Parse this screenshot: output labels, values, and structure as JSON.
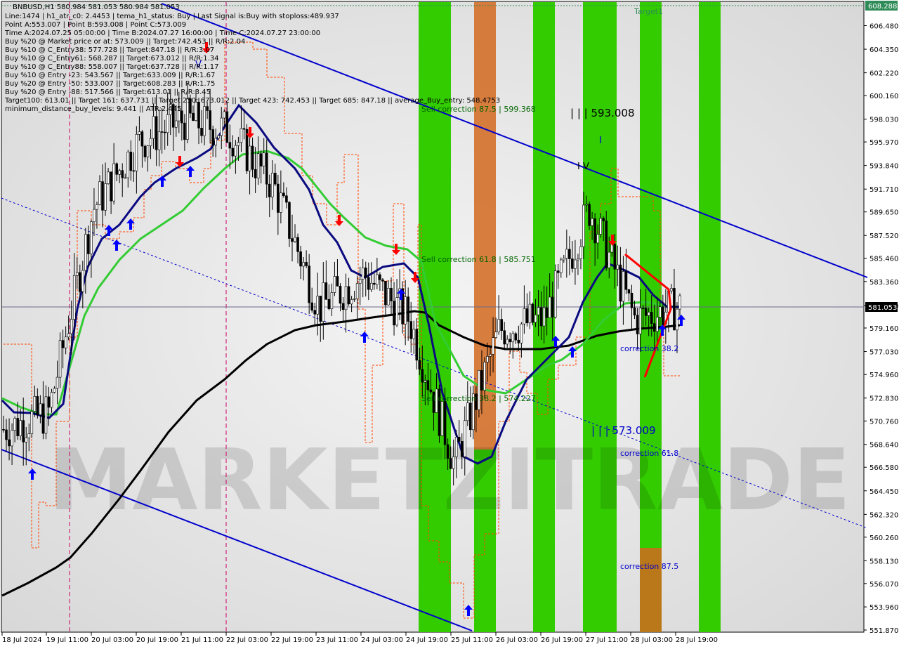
{
  "header": {
    "symbol": "BNBUSD,H1  580.984 581.053 580.984 581.053",
    "lines": [
      "Line:1474  |  h1_atr_c0: 2.4453  |  tema_h1_status: Buy  |  Last Signal is:Buy with stoploss:489.937",
      "Point A:553.007  |  Point B:593.008  |  Point C:573.009",
      "Time A:2024.07.25 05:00:00  |  Time B:2024.07.27 16:00:00  |  Time C:2024.07.27 23:00:00",
      "Buy %20 @ Market price or at: 573.009  ||  Target:742.453  ||  R/R:2.04",
      "Buy %10 @ C_Entry38: 577.728  ||  Target:847.18  ||  R/R:3.07",
      "Buy %10 @ C_Entry61: 568.287  ||  Target:673.012  ||  R/R:1.34",
      "Buy %10 @ C_Entry88: 558.007  ||  Target:637.728  ||  R/R:1.17",
      "Buy %10 @ Entry -23: 543.567  ||  Target:633.009  ||  R/R:1.67",
      "Buy %20 @ Entry -50: 533.007  ||  Target:608.283  ||  R/R:1.75",
      "Buy %20 @ Entry -88: 517.566  ||  Target:613.01  ||  R/R:3.45",
      "Target100: 613.01  ||  Target 161: 637.731  ||  Target 250: 673.012  ||  Target 423: 742.453  ||  Target 685: 847.18  ||  average_Buy_entry: 548.4753",
      "minimum_distance_buy_levels: 9.441  ||  ATR:2.445"
    ]
  },
  "watermark": "MARKETZITRADE",
  "annotations": {
    "sell_correction_875": "Sell correction 87.5 | 599.368",
    "sell_correction_618": "Sell correction 61.8 | 585.751",
    "sell_correction_382": "Sell correction 38.2 | 574.227",
    "point_b": "| | | 593.008",
    "point_c": "| | | 573.009",
    "wave_iv": "I V",
    "wave_v": "V",
    "wave_i": "I",
    "target1": "Target1",
    "correction_382": "correction 38.2",
    "correction_618": "correction 61.8",
    "correction_875": "correction 87.5"
  },
  "price_axis": {
    "ticks": [
      "606.480",
      "604.350",
      "602.220",
      "600.160",
      "598.030",
      "595.970",
      "593.840",
      "591.710",
      "589.650",
      "587.520",
      "585.460",
      "583.360",
      "581.200",
      "579.160",
      "577.030",
      "574.960",
      "572.830",
      "570.760",
      "568.640",
      "566.580",
      "564.450",
      "562.320",
      "560.260",
      "558.130",
      "556.070",
      "553.960",
      "551.870"
    ],
    "current_price": "581.053",
    "top_label": "608.288",
    "current_color": "#000000",
    "top_color": "#2e8b57"
  },
  "time_axis": {
    "ticks": [
      "18 Jul 2024",
      "19 Jul 11:00",
      "20 Jul 03:00",
      "20 Jul 19:00",
      "21 Jul 11:00",
      "22 Jul 03:00",
      "22 Jul 19:00",
      "23 Jul 11:00",
      "24 Jul 03:00",
      "24 Jul 19:00",
      "25 Jul 11:00",
      "26 Jul 03:00",
      "26 Jul 19:00",
      "27 Jul 11:00",
      "28 Jul 03:00",
      "28 Jul 19:00"
    ]
  },
  "colors": {
    "green_zone": "#33cc00",
    "orange_zone": "#d2691e",
    "ema_green": "#33cc33",
    "ema_navy": "#0a0a80",
    "ma_black": "#000000",
    "channel_blue": "#0000cc",
    "stop_orange": "#ff4500",
    "buy_arrow": "#0000ff",
    "sell_arrow": "#ff0000"
  },
  "chart_data": {
    "type": "candlestick",
    "symbol": "BNBUSD",
    "timeframe": "H1",
    "ylim": [
      551.87,
      608.288
    ],
    "last_price": 581.053,
    "series": [
      {
        "name": "price_path",
        "x": [
          "18 Jul 2024",
          "19 Jul 11:00",
          "20 Jul 03:00",
          "20 Jul 19:00",
          "21 Jul 11:00",
          "22 Jul 03:00",
          "22 Jul 19:00",
          "23 Jul 11:00",
          "24 Jul 03:00",
          "24 Jul 19:00",
          "25 Jul 11:00",
          "26 Jul 03:00",
          "26 Jul 19:00",
          "27 Jul 11:00",
          "28 Jul 03:00",
          "28 Jul 19:00"
        ],
        "values": [
          570.0,
          571.5,
          590.0,
          596.0,
          598.0,
          597.0,
          592.0,
          581.0,
          584.0,
          580.0,
          567.0,
          579.0,
          580.0,
          590.0,
          580.0,
          581.05
        ]
      }
    ]
  }
}
